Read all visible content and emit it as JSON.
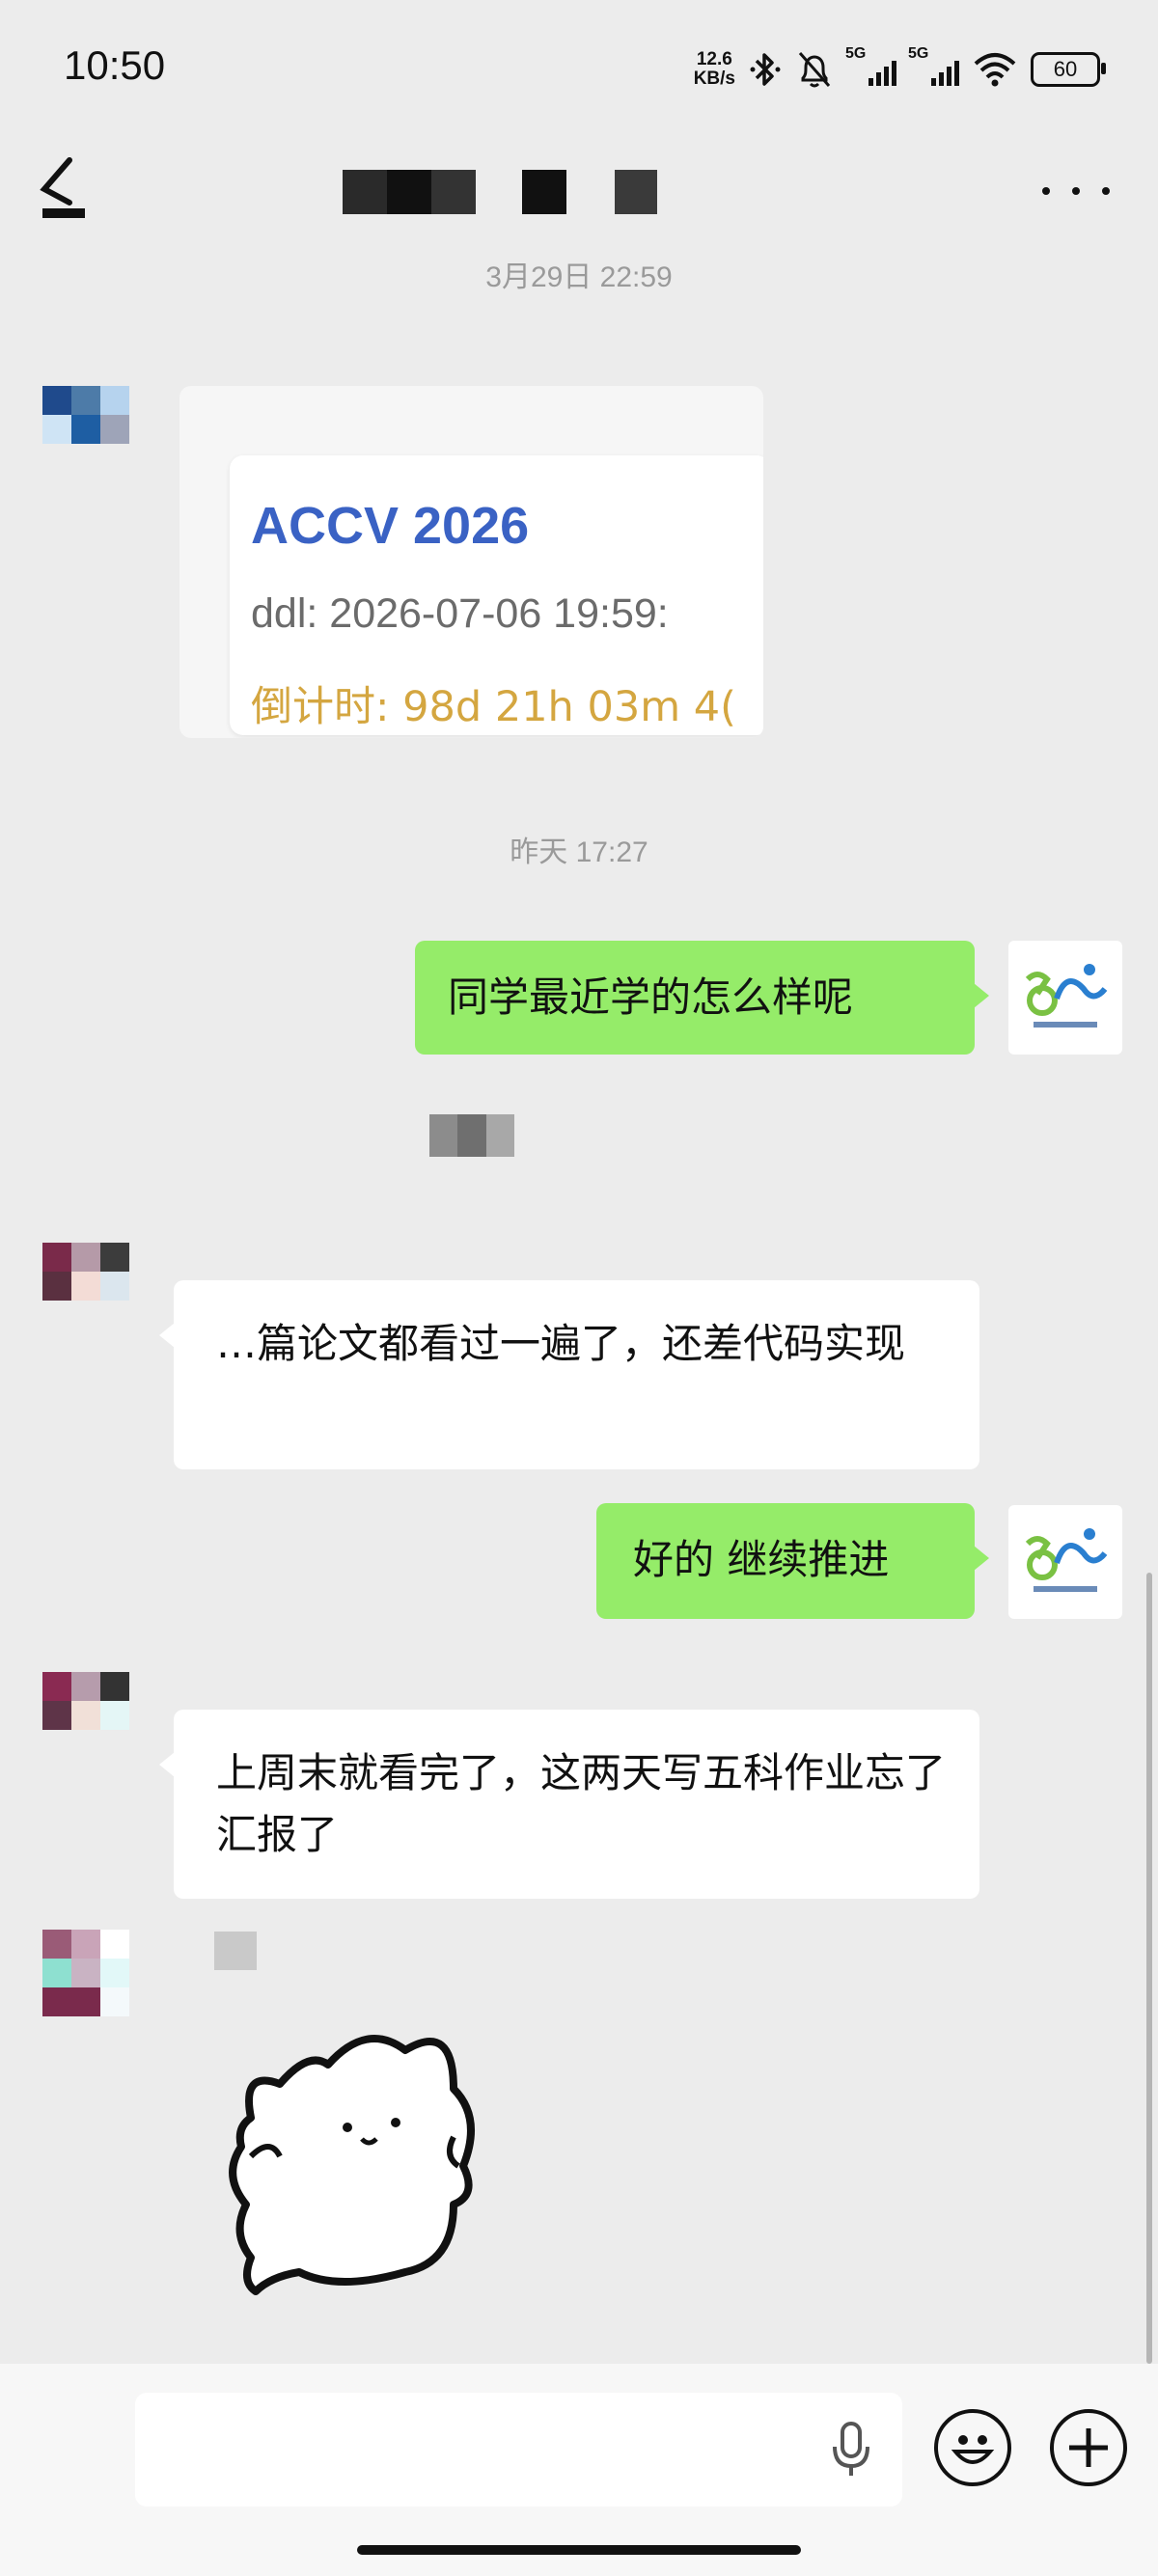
{
  "status_bar": {
    "time": "10:50",
    "net_speed_value": "12.6",
    "net_speed_unit": "KB/s",
    "sim1_label": "5G",
    "sim2_label": "5G",
    "battery": "60"
  },
  "header": {
    "back_icon": "back-arrow-icon",
    "more_icon": "more-dots-icon"
  },
  "messages": {
    "time_1": "3月29日 22:59",
    "card": {
      "title": "ACCV 2026",
      "ddl": "ddl: 2026-07-06 19:59:",
      "countdown": "倒计时: 98d 21h 03m 4("
    },
    "time_2": "昨天 17:27",
    "out_1": "同学最近学的怎么样呢",
    "in_1": "…篇论文都看过一遍了，还差代码实现",
    "out_2": "好的 继续推进",
    "in_2": "上周末就看完了，这两天写五科作业忘了汇报了",
    "sticker": "cat-sticker"
  },
  "input": {
    "placeholder": "",
    "voice_icon": "microphone-icon",
    "emoji_icon": "emoji-icon",
    "plus_icon": "plus-icon"
  },
  "colors": {
    "background": "#ececec",
    "out_bubble": "#95ec69",
    "in_bubble": "#ffffff",
    "card_title": "#3a62c4",
    "countdown": "#d4a640"
  }
}
